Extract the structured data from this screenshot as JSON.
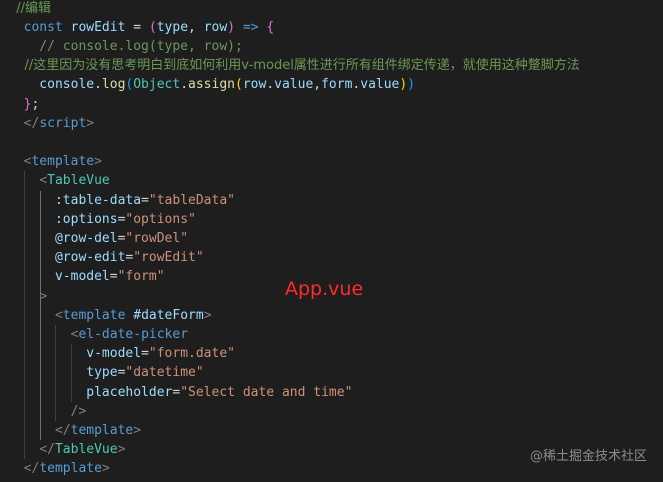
{
  "overlay_label": "App.vue",
  "watermark": "@稀土掘金技术社区",
  "code_lines": [
    [
      {
        "t": "  //编辑",
        "c": "tok-comment"
      }
    ],
    [
      {
        "t": "  const ",
        "c": "tok-keyword"
      },
      {
        "t": "rowEdit",
        "c": "tok-var"
      },
      {
        "t": " = ",
        "c": "tok-op"
      },
      {
        "t": "(",
        "c": "tok-paren1"
      },
      {
        "t": "type",
        "c": "tok-var"
      },
      {
        "t": ", ",
        "c": "tok-op"
      },
      {
        "t": "row",
        "c": "tok-var"
      },
      {
        "t": ")",
        "c": "tok-paren1"
      },
      {
        "t": " => ",
        "c": "tok-keyword"
      },
      {
        "t": "{",
        "c": "tok-paren1"
      }
    ],
    [
      {
        "t": "    // console.log(type, row);",
        "c": "tok-comment"
      }
    ],
    [
      {
        "t": "    //这里因为没有思考明白到底如何利用v-model属性进行所有组件绑定传递，就使用这种蹩脚方法",
        "c": "tok-comment"
      }
    ],
    [
      {
        "t": "    console",
        "c": "tok-var"
      },
      {
        "t": ".",
        "c": "tok-op"
      },
      {
        "t": "log",
        "c": "tok-fn"
      },
      {
        "t": "(",
        "c": "tok-paren2"
      },
      {
        "t": "Object",
        "c": "tok-type"
      },
      {
        "t": ".",
        "c": "tok-op"
      },
      {
        "t": "assign",
        "c": "tok-fn"
      },
      {
        "t": "(",
        "c": "tok-brace"
      },
      {
        "t": "row",
        "c": "tok-var"
      },
      {
        "t": ".",
        "c": "tok-op"
      },
      {
        "t": "value",
        "c": "tok-var"
      },
      {
        "t": ",",
        "c": "tok-op"
      },
      {
        "t": "form",
        "c": "tok-var"
      },
      {
        "t": ".",
        "c": "tok-op"
      },
      {
        "t": "value",
        "c": "tok-var"
      },
      {
        "t": ")",
        "c": "tok-brace"
      },
      {
        "t": ")",
        "c": "tok-paren2"
      }
    ],
    [
      {
        "t": "  ",
        "c": "tok-op"
      },
      {
        "t": "}",
        "c": "tok-paren1"
      },
      {
        "t": ";",
        "c": "tok-op"
      }
    ],
    [
      {
        "t": "  ",
        "c": "tok-op"
      },
      {
        "t": "</",
        "c": "tok-punct"
      },
      {
        "t": "script",
        "c": "tok-tag"
      },
      {
        "t": ">",
        "c": "tok-punct"
      }
    ],
    [],
    [
      {
        "t": "  ",
        "c": "tok-op"
      },
      {
        "t": "<",
        "c": "tok-punct"
      },
      {
        "t": "template",
        "c": "tok-tag"
      },
      {
        "t": ">",
        "c": "tok-punct"
      }
    ],
    [
      {
        "t": "    ",
        "c": "tok-op"
      },
      {
        "t": "<",
        "c": "tok-punct"
      },
      {
        "t": "TableVue",
        "c": "tok-component"
      }
    ],
    [
      {
        "t": "      :table-data",
        "c": "tok-attr"
      },
      {
        "t": "=",
        "c": "tok-op"
      },
      {
        "t": "\"tableData\"",
        "c": "tok-string"
      }
    ],
    [
      {
        "t": "      :options",
        "c": "tok-attr"
      },
      {
        "t": "=",
        "c": "tok-op"
      },
      {
        "t": "\"options\"",
        "c": "tok-string"
      }
    ],
    [
      {
        "t": "      @row-del",
        "c": "tok-attr"
      },
      {
        "t": "=",
        "c": "tok-op"
      },
      {
        "t": "\"rowDel\"",
        "c": "tok-string"
      }
    ],
    [
      {
        "t": "      @row-edit",
        "c": "tok-attr"
      },
      {
        "t": "=",
        "c": "tok-op"
      },
      {
        "t": "\"rowEdit\"",
        "c": "tok-string"
      }
    ],
    [
      {
        "t": "      v-model",
        "c": "tok-attr"
      },
      {
        "t": "=",
        "c": "tok-op"
      },
      {
        "t": "\"form\"",
        "c": "tok-string"
      }
    ],
    [
      {
        "t": "    ",
        "c": "tok-op"
      },
      {
        "t": ">",
        "c": "tok-punct"
      }
    ],
    [
      {
        "t": "      ",
        "c": "tok-op"
      },
      {
        "t": "<",
        "c": "tok-punct"
      },
      {
        "t": "template",
        "c": "tok-tag"
      },
      {
        "t": " #dateForm",
        "c": "tok-attr"
      },
      {
        "t": ">",
        "c": "tok-punct"
      }
    ],
    [
      {
        "t": "        ",
        "c": "tok-op"
      },
      {
        "t": "<",
        "c": "tok-punct"
      },
      {
        "t": "el-date-picker",
        "c": "tok-tag"
      }
    ],
    [
      {
        "t": "          v-model",
        "c": "tok-attr"
      },
      {
        "t": "=",
        "c": "tok-op"
      },
      {
        "t": "\"form.date\"",
        "c": "tok-string"
      }
    ],
    [
      {
        "t": "          type",
        "c": "tok-attr"
      },
      {
        "t": "=",
        "c": "tok-op"
      },
      {
        "t": "\"datetime\"",
        "c": "tok-string"
      }
    ],
    [
      {
        "t": "          placeholder",
        "c": "tok-attr"
      },
      {
        "t": "=",
        "c": "tok-op"
      },
      {
        "t": "\"Select date and time\"",
        "c": "tok-string"
      }
    ],
    [
      {
        "t": "        ",
        "c": "tok-op"
      },
      {
        "t": "/>",
        "c": "tok-punct"
      }
    ],
    [
      {
        "t": "      ",
        "c": "tok-op"
      },
      {
        "t": "</",
        "c": "tok-punct"
      },
      {
        "t": "template",
        "c": "tok-tag"
      },
      {
        "t": ">",
        "c": "tok-punct"
      }
    ],
    [
      {
        "t": "    ",
        "c": "tok-op"
      },
      {
        "t": "</",
        "c": "tok-punct"
      },
      {
        "t": "TableVue",
        "c": "tok-component"
      },
      {
        "t": ">",
        "c": "tok-punct"
      }
    ],
    [
      {
        "t": "  ",
        "c": "tok-op"
      },
      {
        "t": "</",
        "c": "tok-punct"
      },
      {
        "t": "template",
        "c": "tok-tag"
      },
      {
        "t": ">",
        "c": "tok-punct"
      }
    ]
  ]
}
